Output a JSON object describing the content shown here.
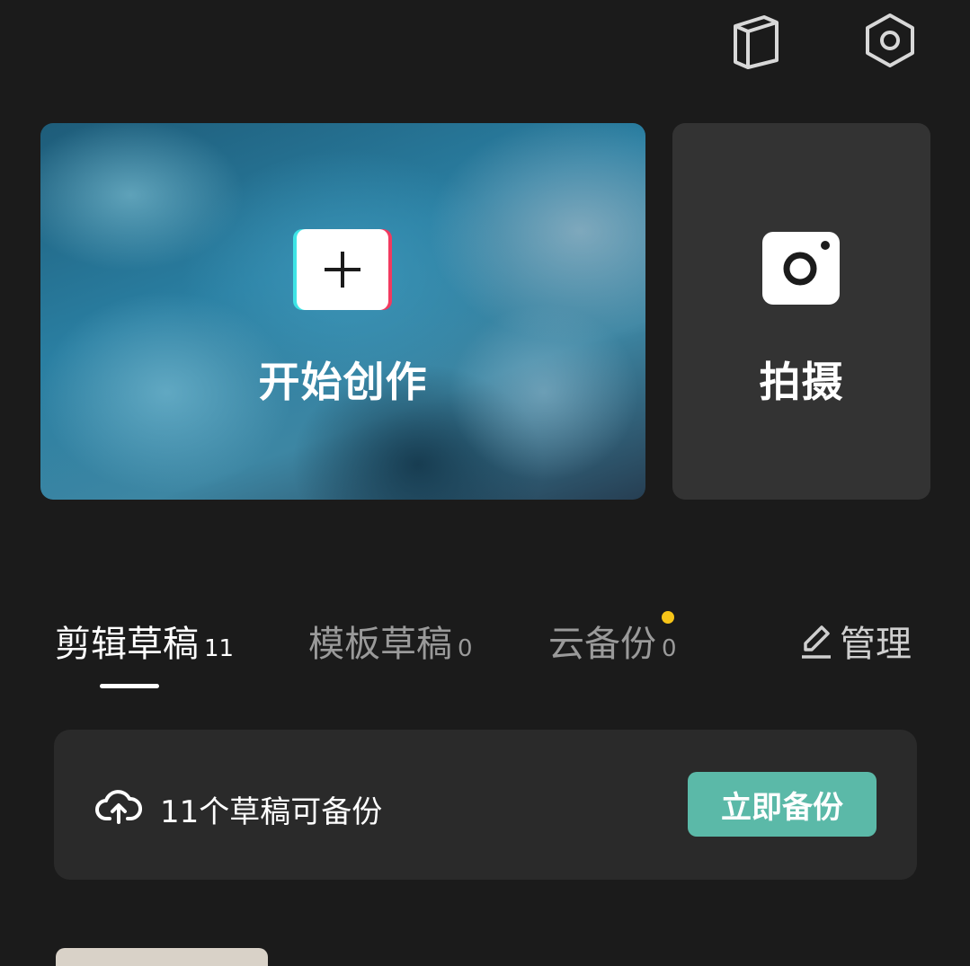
{
  "header": {
    "icons": [
      "book-icon",
      "settings-hexagon-icon"
    ]
  },
  "create_card": {
    "label": "开始创作",
    "icon": "plus-icon"
  },
  "shoot_card": {
    "label": "拍摄",
    "icon": "camera-icon"
  },
  "tabs": [
    {
      "label": "剪辑草稿",
      "count": "11",
      "active": true
    },
    {
      "label": "模板草稿",
      "count": "0",
      "active": false
    },
    {
      "label": "云备份",
      "count": "0",
      "active": false,
      "badge_dot": true
    }
  ],
  "manage": {
    "label": "管理",
    "icon": "edit-pen-icon"
  },
  "backup_banner": {
    "icon": "cloud-upload-icon",
    "message": "11个草稿可备份",
    "button_label": "立即备份"
  },
  "colors": {
    "background": "#1b1b1b",
    "card_dark": "#333333",
    "accent_teal": "#5bb9a8",
    "badge_yellow": "#f6c418"
  }
}
